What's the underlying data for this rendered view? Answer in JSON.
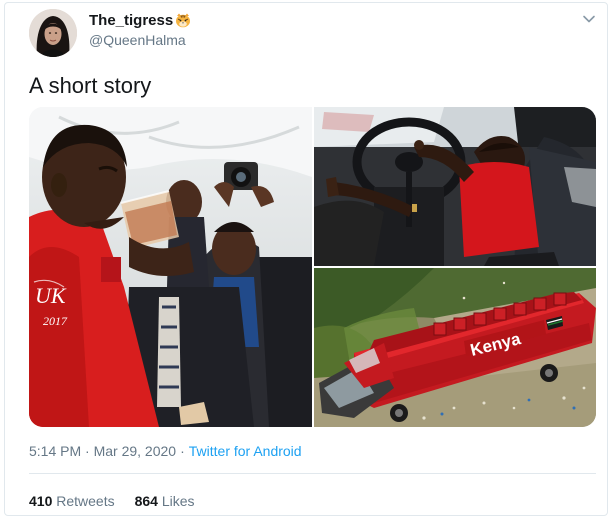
{
  "tweet": {
    "author": {
      "display_name": "The_tigress",
      "handle": "@QueenHalma"
    },
    "text": "A short story",
    "media": {
      "bus_banner_text": "Kenya",
      "shirt_text": "UK",
      "shirt_year": "2017"
    },
    "timestamp": "5:14 PM · Mar 29, 2020",
    "separator": "·",
    "source": "Twitter for Android",
    "retweets": {
      "count": "410",
      "label": "Retweets"
    },
    "likes": {
      "count": "864",
      "label": "Likes"
    }
  },
  "colors": {
    "accent": "#1da1f2",
    "secondary_text": "#657786",
    "divider": "#e1e8ed"
  },
  "icons": {
    "menu": "chevron-down-icon",
    "name_emoji": "tiger-face-emoji"
  }
}
